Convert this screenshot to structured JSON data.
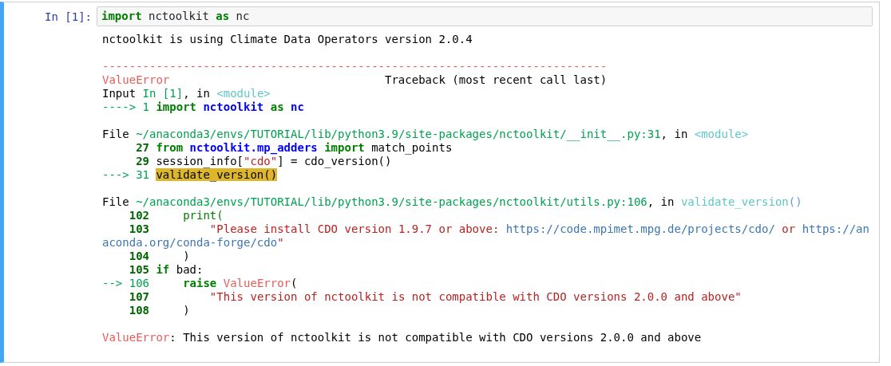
{
  "cell": {
    "prompt": "In [1]:",
    "selected": true,
    "input": [
      {
        "text": "import",
        "kind": "keyword"
      },
      {
        "text": " nctoolkit ",
        "kind": "plain"
      },
      {
        "text": "as",
        "kind": "keyword"
      },
      {
        "text": " nc",
        "kind": "plain"
      }
    ],
    "output_blocks": [
      {
        "lines": [
          {
            "segments": [
              {
                "text": "nctoolkit is using Climate Data Operators version 2.0.4",
                "kind": "plain"
              }
            ]
          }
        ]
      },
      {
        "lines": [
          {
            "segments": [
              {
                "text": "---------------------------------------------------------------------------",
                "kind": "error"
              }
            ]
          },
          {
            "segments": [
              {
                "text": "ValueError",
                "kind": "error"
              },
              {
                "text": "                                Traceback (most recent call last)",
                "kind": "plain"
              }
            ]
          },
          {
            "segments": [
              {
                "text": "Input ",
                "kind": "plain"
              },
              {
                "text": "In [1]",
                "kind": "path"
              },
              {
                "text": ", in ",
                "kind": "plain"
              },
              {
                "text": "<module>",
                "kind": "module"
              }
            ]
          },
          {
            "segments": [
              {
                "text": "----> 1 ",
                "kind": "path"
              },
              {
                "text": "import",
                "kind": "keyword"
              },
              {
                "text": " nctoolkit",
                "kind": "name"
              },
              {
                "text": " as",
                "kind": "keyword"
              },
              {
                "text": " nc",
                "kind": "name"
              }
            ]
          }
        ]
      },
      {
        "lines": [
          {
            "segments": [
              {
                "text": "File ",
                "kind": "plain"
              },
              {
                "text": "~/anaconda3/envs/TUTORIAL/lib/python3.9/site-packages/nctoolkit/__init__.py:31",
                "kind": "path"
              },
              {
                "text": ", in ",
                "kind": "plain"
              },
              {
                "text": "<module>",
                "kind": "module"
              }
            ]
          },
          {
            "segments": [
              {
                "text": "     27",
                "kind": "lineno"
              },
              {
                "text": " from",
                "kind": "keyword"
              },
              {
                "text": " nctoolkit.mp_adders",
                "kind": "name"
              },
              {
                "text": " import",
                "kind": "keyword"
              },
              {
                "text": " match_points",
                "kind": "plain"
              }
            ]
          },
          {
            "segments": [
              {
                "text": "     29",
                "kind": "lineno"
              },
              {
                "text": " session_info[",
                "kind": "plain"
              },
              {
                "text": "\"cdo\"",
                "kind": "string"
              },
              {
                "text": "] = cdo_version()",
                "kind": "plain"
              }
            ]
          },
          {
            "segments": [
              {
                "text": "---> 31 ",
                "kind": "path"
              },
              {
                "text": "validate_version()",
                "kind": "highlight"
              }
            ]
          }
        ]
      },
      {
        "lines": [
          {
            "segments": [
              {
                "text": "File ",
                "kind": "plain"
              },
              {
                "text": "~/anaconda3/envs/TUTORIAL/lib/python3.9/site-packages/nctoolkit/utils.py:106",
                "kind": "path"
              },
              {
                "text": ", in ",
                "kind": "plain"
              },
              {
                "text": "validate_version",
                "kind": "module"
              },
              {
                "text": "()",
                "kind": "paren"
              }
            ]
          },
          {
            "segments": [
              {
                "text": "    102",
                "kind": "lineno"
              },
              {
                "text": "     print(",
                "kind": "builtin"
              }
            ]
          },
          {
            "segments": [
              {
                "text": "    103",
                "kind": "lineno"
              },
              {
                "text": "         \"Please install CDO version 1.9.7 or above: ",
                "kind": "string"
              },
              {
                "text": "https://code.mpimet.mpg.de/projects/cdo/",
                "kind": "url"
              },
              {
                "text": " or ",
                "kind": "string"
              },
              {
                "text": "https://an",
                "kind": "url"
              }
            ]
          },
          {
            "segments": [
              {
                "text": "aconda.org/conda-forge/cdo",
                "kind": "url"
              },
              {
                "text": "\"",
                "kind": "string"
              }
            ]
          },
          {
            "segments": [
              {
                "text": "    104",
                "kind": "lineno"
              },
              {
                "text": "     )",
                "kind": "plain"
              }
            ]
          },
          {
            "segments": [
              {
                "text": "    105",
                "kind": "lineno"
              },
              {
                "text": " if",
                "kind": "keyword"
              },
              {
                "text": " bad:",
                "kind": "plain"
              }
            ]
          },
          {
            "segments": [
              {
                "text": "--> 106",
                "kind": "path"
              },
              {
                "text": "     raise",
                "kind": "keyword"
              },
              {
                "text": " ValueError",
                "kind": "error"
              },
              {
                "text": "(",
                "kind": "plain"
              }
            ]
          },
          {
            "segments": [
              {
                "text": "    107",
                "kind": "lineno"
              },
              {
                "text": "         \"This version of nctoolkit is not compatible with CDO versions 2.0.0 and above\"",
                "kind": "string"
              }
            ]
          },
          {
            "segments": [
              {
                "text": "    108",
                "kind": "lineno"
              },
              {
                "text": "     )",
                "kind": "plain"
              }
            ]
          }
        ]
      },
      {
        "lines": [
          {
            "segments": [
              {
                "text": "ValueError",
                "kind": "error"
              },
              {
                "text": ": This version of nctoolkit is not compatible with CDO versions 2.0.0 and above",
                "kind": "plain"
              }
            ]
          }
        ]
      }
    ]
  }
}
